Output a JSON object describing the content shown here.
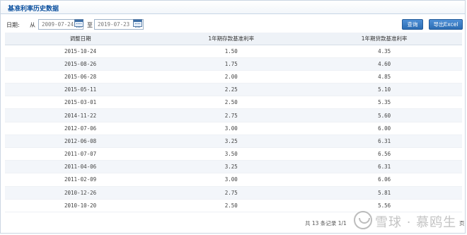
{
  "header": {
    "title": "基准利率历史数据"
  },
  "filter": {
    "date_label": "日期:",
    "from_label": "从",
    "start_date": "2009-07-24",
    "to_label": "至",
    "end_date": "2019-07-23",
    "query_button": "查询",
    "export_button": "导出Excel"
  },
  "table": {
    "columns": [
      "调整日期",
      "1年期存款基准利率",
      "1年期贷款基准利率"
    ],
    "rows": [
      [
        "2015-10-24",
        "1.50",
        "4.35"
      ],
      [
        "2015-08-26",
        "1.75",
        "4.60"
      ],
      [
        "2015-06-28",
        "2.00",
        "4.85"
      ],
      [
        "2015-05-11",
        "2.25",
        "5.10"
      ],
      [
        "2015-03-01",
        "2.50",
        "5.35"
      ],
      [
        "2014-11-22",
        "2.75",
        "5.60"
      ],
      [
        "2012-07-06",
        "3.00",
        "6.00"
      ],
      [
        "2012-06-08",
        "3.25",
        "6.31"
      ],
      [
        "2011-07-07",
        "3.50",
        "6.56"
      ],
      [
        "2011-04-06",
        "3.25",
        "6.31"
      ],
      [
        "2011-02-09",
        "3.00",
        "6.06"
      ],
      [
        "2010-12-26",
        "2.75",
        "5.81"
      ],
      [
        "2010-10-20",
        "2.50",
        "5.56"
      ]
    ]
  },
  "pager": {
    "summary": "共 13 条记录 1/1",
    "page_suffix": "页"
  },
  "watermark": {
    "text": "雪球 · 慕鸥生"
  },
  "colors": {
    "title": "#0a4f9e",
    "button": "#2b6cb3",
    "header_bg": "#eef2f7",
    "alt_row": "#f3f6fa"
  }
}
